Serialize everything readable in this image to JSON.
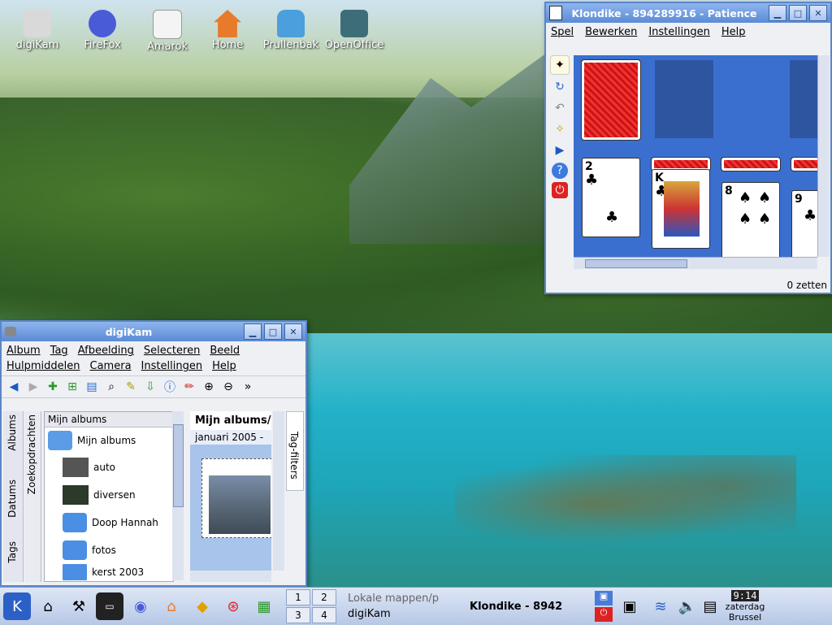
{
  "desktop": {
    "icons": [
      {
        "label": "digiKam",
        "icon": "camera-icon",
        "color": "#d9d9d9"
      },
      {
        "label": "FireFox",
        "icon": "firefox-icon",
        "color": "#4a5bd8"
      },
      {
        "label": "Amarok",
        "icon": "document-icon",
        "color": "#f4f4f4"
      },
      {
        "label": "Home",
        "icon": "home-icon",
        "color": "#e87a2c"
      },
      {
        "label": "Prullenbak",
        "icon": "trash-icon",
        "color": "#4b9fdc"
      },
      {
        "label": "OpenOffice",
        "icon": "openoffice-icon",
        "color": "#3e6d7a"
      }
    ]
  },
  "klondike": {
    "title": "Klondike - 894289916 - Patience",
    "menu": [
      "Spel",
      "Bewerken",
      "Instellingen",
      "Help"
    ],
    "cards": {
      "c1": {
        "rank": "2",
        "suit": "♣"
      },
      "c2": {
        "rank": "K",
        "suit": "♣"
      },
      "c3": {
        "rank": "8",
        "suit": "♠"
      },
      "c4": {
        "rank": "9",
        "suit": "♣"
      }
    },
    "status": "0 zetten"
  },
  "digikam": {
    "title": "digiKam",
    "menu_row1": [
      "Album",
      "Tag",
      "Afbeelding",
      "Selecteren",
      "Beeld"
    ],
    "menu_row2": [
      "Hulpmiddelen",
      "Camera",
      "Instellingen",
      "Help"
    ],
    "side_tabs": [
      "Albums",
      "Datums",
      "Tags"
    ],
    "side_tab2": "Zoekopdrachten",
    "tree_header": "Mijn albums",
    "tree_root": "Mijn albums",
    "albums": [
      "auto",
      "diversen",
      "Doop Hannah",
      "fotos",
      "kerst 2003"
    ],
    "preview_path": "Mijn albums/",
    "preview_date": "januari 2005 -",
    "tag_filters": "Tag-filters"
  },
  "taskbar": {
    "pager": [
      "1",
      "2",
      "3",
      "4"
    ],
    "tasks": [
      "Lokale mappen/p",
      "Klondike - 8942",
      "digiKam"
    ],
    "clock": "9:14",
    "date": "zaterdag",
    "location": "Brussel"
  },
  "colors": {
    "accent": "#5a8bd6",
    "felt": "#3a6fd0"
  }
}
